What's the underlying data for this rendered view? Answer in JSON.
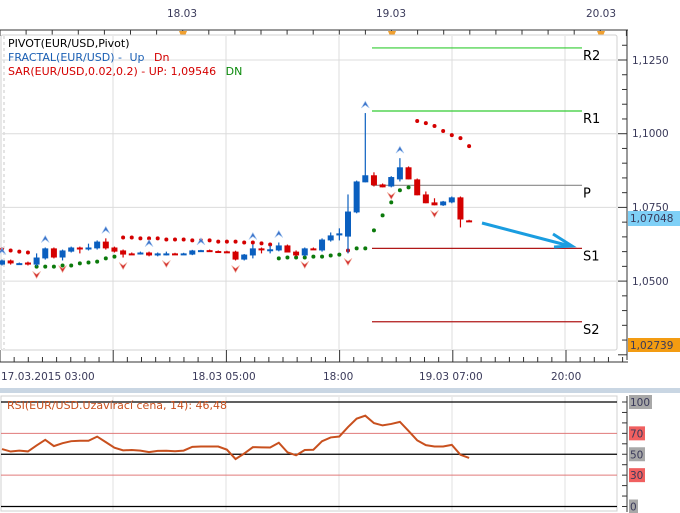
{
  "legend": {
    "pivot": "PIVOT(EUR/USD,Pivot)",
    "fractal": "FRACTAL(EUR/USD)  - ",
    "fractal_up": "Up",
    "fractal_dn": "Dn",
    "sar": "SAR(EUR/USD,0.02,0.2) -  UP: 1,09546",
    "sar_dn": "DN"
  },
  "colors": {
    "up_candle": "#0a5fbf",
    "down_candle": "#d40000",
    "sar_up": "#0b7a0b",
    "sar_down": "#d40000",
    "resistance": "#33cc33",
    "pivot": "#888888",
    "support": "#b01818",
    "rsi_line": "#c8501e",
    "arrow": "#1a9de0",
    "current_price_bg": "#7fd0f7",
    "low_price_bg": "#f39c12"
  },
  "chart_data": [
    {
      "type": "candlestick",
      "title": "",
      "top_axis_labels": [
        "18.03",
        "19.03",
        "20.03"
      ],
      "x_tick_labels": [
        "17.03.2015 03:00",
        "18.03 05:00",
        "18:00",
        "19.03 07:00",
        "20:00"
      ],
      "y_tick_labels": [
        "1,1250",
        "1,1000",
        "1,0750",
        "1,0500"
      ],
      "ylim": [
        1.0245,
        1.1335
      ],
      "grid": true,
      "current_price_label": "1,07048",
      "low_price_label": "1,02739",
      "candles_ohlc": [
        [
          1.0556,
          1.0573,
          1.0553,
          1.057
        ],
        [
          1.057,
          1.0573,
          1.0556,
          1.056
        ],
        [
          1.056,
          1.0563,
          1.0556,
          1.0561
        ],
        [
          1.0563,
          1.0566,
          1.0553,
          1.0556
        ],
        [
          1.0556,
          1.0594,
          1.055,
          1.058
        ],
        [
          1.0577,
          1.0614,
          1.0573,
          1.0611
        ],
        [
          1.0611,
          1.0614,
          1.0577,
          1.058
        ],
        [
          1.058,
          1.0607,
          1.057,
          1.0604
        ],
        [
          1.06,
          1.0617,
          1.0597,
          1.0614
        ],
        [
          1.0614,
          1.0617,
          1.0594,
          1.0611
        ],
        [
          1.0613,
          1.0627,
          1.0604,
          1.0614
        ],
        [
          1.0611,
          1.0638,
          1.0607,
          1.0634
        ],
        [
          1.0634,
          1.0645,
          1.0607,
          1.0611
        ],
        [
          1.0614,
          1.0617,
          1.0597,
          1.06
        ],
        [
          1.0604,
          1.0607,
          1.058,
          1.059
        ],
        [
          1.0594,
          1.0597,
          1.059,
          1.0592
        ],
        [
          1.0594,
          1.06,
          1.059,
          1.0597
        ],
        [
          1.0597,
          1.06,
          1.0584,
          1.0587
        ],
        [
          1.0587,
          1.0597,
          1.0584,
          1.0594
        ],
        [
          1.0593,
          1.06,
          1.0587,
          1.0594
        ],
        [
          1.0594,
          1.0596,
          1.0591,
          1.0592
        ],
        [
          1.0592,
          1.0596,
          1.059,
          1.0594
        ],
        [
          1.059,
          1.0606,
          1.0588,
          1.0604
        ],
        [
          1.0603,
          1.0606,
          1.0601,
          1.0605
        ],
        [
          1.0605,
          1.0607,
          1.0601,
          1.0603
        ],
        [
          1.0602,
          1.0604,
          1.0598,
          1.06
        ],
        [
          1.0601,
          1.0603,
          1.0598,
          1.0599
        ],
        [
          1.06,
          1.0603,
          1.057,
          1.0573
        ],
        [
          1.0573,
          1.0592,
          1.057,
          1.059
        ],
        [
          1.0587,
          1.0624,
          1.0577,
          1.0611
        ],
        [
          1.0611,
          1.0614,
          1.0594,
          1.0607
        ],
        [
          1.0606,
          1.0621,
          1.0594,
          1.0608
        ],
        [
          1.0604,
          1.0631,
          1.0601,
          1.0621
        ],
        [
          1.0621,
          1.0624,
          1.0597,
          1.0597
        ],
        [
          1.06,
          1.0604,
          1.0584,
          1.0587
        ],
        [
          1.0587,
          1.0614,
          1.0584,
          1.0611
        ],
        [
          1.0611,
          1.0614,
          1.0607,
          1.0607
        ],
        [
          1.0604,
          1.0645,
          1.06,
          1.0641
        ],
        [
          1.0638,
          1.0665,
          1.0634,
          1.0655
        ],
        [
          1.0655,
          1.0679,
          1.0638,
          1.0662
        ],
        [
          1.0651,
          1.0794,
          1.0594,
          1.0736
        ],
        [
          1.0733,
          1.0841,
          1.073,
          1.0838
        ],
        [
          1.0835,
          1.107,
          1.0835,
          1.0859
        ],
        [
          1.0859,
          1.0869,
          1.0821,
          1.0825
        ],
        [
          1.0828,
          1.0831,
          1.0818,
          1.0818
        ],
        [
          1.0821,
          1.0856,
          1.0818,
          1.0853
        ],
        [
          1.0845,
          1.0917,
          1.0838,
          1.0886
        ],
        [
          1.0886,
          1.0889,
          1.0845,
          1.0845
        ],
        [
          1.0845,
          1.0848,
          1.0791,
          1.0791
        ],
        [
          1.0794,
          1.0804,
          1.0764,
          1.0764
        ],
        [
          1.0767,
          1.0781,
          1.0757,
          1.0757
        ],
        [
          1.0757,
          1.0772,
          1.0755,
          1.077
        ],
        [
          1.0767,
          1.0787,
          1.0764,
          1.0784
        ],
        [
          1.0784,
          1.0787,
          1.0682,
          1.0709
        ],
        [
          1.0706,
          1.0708,
          1.0703,
          1.0705
        ]
      ],
      "sar": [
        1.0607,
        1.0604,
        1.06,
        1.0597,
        1.0549,
        1.0549,
        1.0549,
        1.0553,
        1.0553,
        1.056,
        1.0563,
        1.0566,
        1.0577,
        1.0583,
        1.0648,
        1.0648,
        1.0645,
        1.0645,
        1.0645,
        1.0641,
        1.0641,
        1.0641,
        1.0638,
        1.0638,
        1.0638,
        1.0634,
        1.0634,
        1.0634,
        1.0631,
        1.0631,
        1.0628,
        1.0624,
        1.0577,
        1.058,
        1.058,
        1.058,
        1.0583,
        1.0583,
        1.0587,
        1.059,
        1.0604,
        1.0611,
        1.0611,
        1.0672,
        1.0723,
        1.0767,
        1.0808,
        1.0818,
        1.1043,
        1.1036,
        1.1026,
        1.1009,
        1.0995,
        1.0985,
        1.0958
      ],
      "fractal_up_candles": [
        0,
        5,
        12,
        17,
        23,
        29,
        32,
        42,
        46
      ],
      "fractal_down_candles": [
        4,
        7,
        14,
        19,
        27,
        35,
        40,
        45,
        50
      ],
      "pivot_levels": [
        {
          "label": "R2",
          "value": 1.1291,
          "kind": "resistance"
        },
        {
          "label": "R1",
          "value": 1.1077,
          "kind": "resistance"
        },
        {
          "label": "P",
          "value": 1.0825,
          "kind": "pivot"
        },
        {
          "label": "S1",
          "value": 1.0611,
          "kind": "support"
        },
        {
          "label": "S2",
          "value": 1.0362,
          "kind": "support"
        }
      ]
    },
    {
      "type": "line",
      "title": "RSI(EUR/USD.Uzavírací cena, 14): 46,48",
      "ylim": [
        0,
        100
      ],
      "y_tick_labels": [
        "100",
        "70",
        "50",
        "30",
        "0"
      ],
      "levels": [
        100,
        70,
        50,
        30,
        0
      ],
      "values": [
        55.0,
        52.6,
        53.5,
        52.7,
        58.4,
        63.8,
        57.8,
        60.6,
        62.5,
        62.9,
        62.9,
        66.9,
        61.6,
        56.3,
        53.7,
        54.1,
        53.5,
        52.1,
        53.2,
        53.3,
        52.9,
        53.5,
        57.1,
        57.4,
        57.4,
        57.4,
        54.4,
        45.4,
        50.7,
        56.8,
        56.6,
        56.5,
        61.0,
        51.9,
        49.0,
        54.1,
        54.3,
        62.5,
        66.1,
        67.0,
        76.0,
        84.1,
        86.9,
        79.8,
        77.6,
        79.0,
        81.0,
        72.3,
        63.3,
        58.7,
        57.4,
        57.4,
        59.0,
        49.5,
        46.5
      ]
    }
  ]
}
